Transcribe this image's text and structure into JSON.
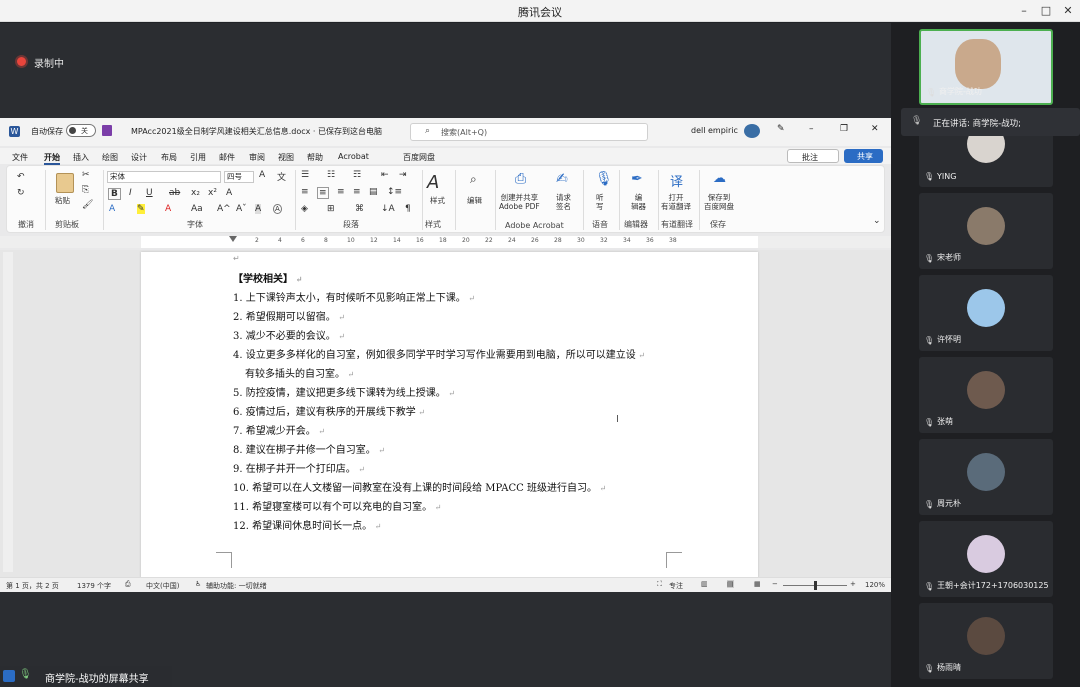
{
  "app": {
    "title": "腾讯会议"
  },
  "recording": {
    "label": "录制中"
  },
  "word": {
    "autosave_label": "自动保存",
    "autosave_state": "关",
    "doc_title": "MPAcc2021级全日制学风建设相关汇总信息.docx  ·  已保存到这台电脑",
    "search_placeholder": "搜索(Alt+Q)",
    "user_name": "dell empiric",
    "menu": [
      "文件",
      "开始",
      "插入",
      "绘图",
      "设计",
      "布局",
      "引用",
      "邮件",
      "审阅",
      "视图",
      "帮助",
      "Acrobat",
      "百度网盘"
    ],
    "comment_btn": "批注",
    "share_btn": "共享",
    "ribbon": {
      "undo_group": "撤消",
      "clipboard_group": "剪贴板",
      "paste": "粘贴",
      "font_name": "宋体",
      "font_size": "四号",
      "font_group": "字体",
      "paragraph_group": "段落",
      "styles": "样式",
      "styles_group": "样式",
      "edit": "编辑",
      "acrobat_create": [
        "创建并共享",
        "Adobe PDF"
      ],
      "acrobat_sign": [
        "请求",
        "签名"
      ],
      "acrobat_group": "Adobe Acrobat",
      "dictate": [
        "听",
        "写"
      ],
      "voice_group": "语音",
      "editor": [
        "编",
        "辑器"
      ],
      "editor_group": "编辑器",
      "translate": [
        "打开",
        "有道翻译"
      ],
      "translate_group": "有道翻译",
      "baidu": [
        "保存到",
        "百度网盘"
      ],
      "save_group": "保存"
    },
    "ruler_ticks": [
      "2",
      "4",
      "6",
      "8",
      "10",
      "12",
      "14",
      "16",
      "18",
      "20",
      "22",
      "24",
      "26",
      "28",
      "30",
      "32",
      "34",
      "36",
      "38"
    ],
    "doc_lines": [
      "【学校相关】",
      "1. 上下课铃声太小，有时候听不见影响正常上下课。",
      "2. 希望假期可以留宿。",
      "3. 减少不必要的会议。",
      "4. 设立更多多样化的自习室，例如很多同学平时学习写作业需要用到电脑，所以可以建立设",
      "有较多插头的自习室。",
      "5. 防控疫情，建议把更多线下课转为线上授课。",
      "6. 疫情过后，建议有秩序的开展线下教学",
      "7. 希望减少开会。",
      "8. 建议在梆子井修一个自习室。",
      "9. 在梆子井开一个打印店。",
      "10. 希望可以在人文楼留一间教室在没有上课的时间段给 MPACC 班级进行自习。",
      "11. 希望寝室楼可以有个可以充电的自习室。",
      "12. 希望课间休息时间长一点。"
    ],
    "status": {
      "page": "第 1 页，共 2 页",
      "words": "1379 个字",
      "lang": "中文(中国)",
      "accessibility": "辅助功能: 一切就绪",
      "focus": "专注",
      "zoom": "120%"
    }
  },
  "participants": [
    {
      "name": "商学院-战功",
      "avatar_color": "#c9a98c"
    },
    {
      "name": "YING",
      "avatar_color": "#d9d4cf"
    },
    {
      "name": "宋老师",
      "avatar_color": "#8a7a6a"
    },
    {
      "name": "许怀明",
      "avatar_color": "#9cc7ea"
    },
    {
      "name": "张萌",
      "avatar_color": "#6e5a4e"
    },
    {
      "name": "周元朴",
      "avatar_color": "#5a6b7a"
    },
    {
      "name": "王朝+会计172+1706030125",
      "avatar_color": "#d9cbe0"
    },
    {
      "name": "杨雨晴",
      "avatar_color": "#5b4a40"
    }
  ],
  "speaking": {
    "label": "正在讲话: 商学院-战功;"
  },
  "share_label": "商学院-战功的屏幕共享"
}
